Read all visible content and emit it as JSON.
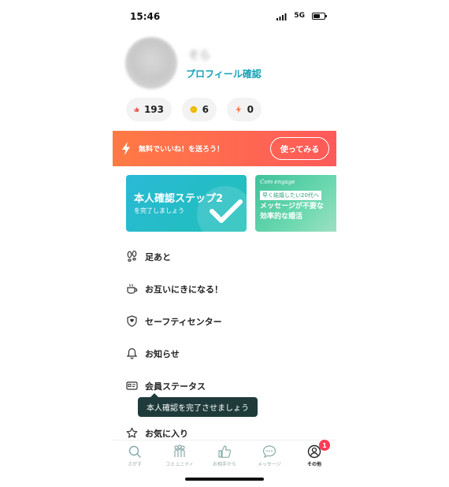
{
  "status_bar": {
    "time": "15:46",
    "network": "5G"
  },
  "profile": {
    "name": "そら",
    "link": "プロフィール確認"
  },
  "stats": [
    {
      "icon": "thumbs-up-icon",
      "value": "193"
    },
    {
      "icon": "coin-icon",
      "value": "6"
    },
    {
      "icon": "lightning-icon",
      "value": "0"
    }
  ],
  "promo": {
    "text": "無料でいいね！を送ろう！",
    "button": "使ってみる"
  },
  "cards": {
    "verify": {
      "title": "本人確認ステップ2",
      "subtitle": "を完了しましょう"
    },
    "engage": {
      "brand": "Com engage",
      "tag": "早く結婚したい20代へ",
      "line1": "メッセージが不要な",
      "line2": "効率的な婚活"
    }
  },
  "menu": [
    {
      "label": "足あと",
      "icon": "footprints-icon"
    },
    {
      "label": "お互いにきになる！",
      "icon": "coffee-cup-icon"
    },
    {
      "label": "セーフティセンター",
      "icon": "shield-icon"
    },
    {
      "label": "お知らせ",
      "icon": "bell-icon"
    },
    {
      "label": "会員ステータス",
      "icon": "id-card-icon"
    },
    {
      "label": "お気に入り",
      "icon": "star-icon"
    }
  ],
  "tooltip": "本人確認を完了させましょう",
  "tabs": [
    {
      "label": "さがす",
      "icon": "search-icon"
    },
    {
      "label": "コミュニティ",
      "icon": "community-icon"
    },
    {
      "label": "お相手から",
      "icon": "thumbs-up-icon"
    },
    {
      "label": "メッセージ",
      "icon": "message-icon"
    },
    {
      "label": "その他",
      "icon": "profile-icon"
    }
  ],
  "badge": "1",
  "colors": {
    "accent": "#17a2b8",
    "promo_start": "#ff7a45",
    "promo_end": "#ff5a5a",
    "card_teal": "#2ab9d6",
    "badge": "#ff3b55"
  }
}
